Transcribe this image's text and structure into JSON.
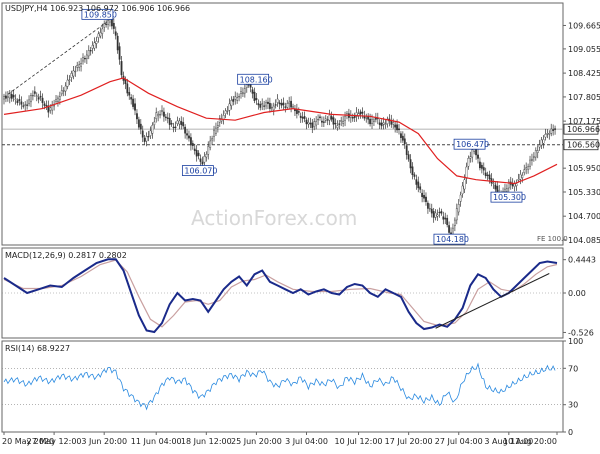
{
  "chart_data": [
    {
      "type": "candlestick",
      "panel": "price",
      "header": "USDJPY,H4  106.923 106.972 106.906 106.966",
      "watermark": "ActionForex.com",
      "fe_label": "FE 100.0",
      "last_price": "106.966",
      "y_ticks": [
        "109.665",
        "109.055",
        "108.425",
        "107.805",
        "107.175",
        "106.560",
        "105.950",
        "105.330",
        "104.700",
        "104.085"
      ],
      "ylim": [
        103.95,
        110.25
      ],
      "x_ticks": [
        "20 May 2020",
        "27 May 12:00",
        "3 Jun 20:00",
        "11 Jun 04:00",
        "18 Jun 12:00",
        "25 Jun 20:00",
        "3 Jul 04:00",
        "10 Jul 12:00",
        "17 Jul 20:00",
        "27 Jul 04:00",
        "3 Aug 12:00",
        "10 Aug 20:00"
      ],
      "annotations": [
        {
          "label": "109.850",
          "value": 109.85
        },
        {
          "label": "106.070",
          "value": 106.07
        },
        {
          "label": "108.160",
          "value": 108.16
        },
        {
          "label": "106.470",
          "value": 106.47
        },
        {
          "label": "105.300",
          "value": 105.3
        },
        {
          "label": "104.180",
          "value": 104.18
        }
      ],
      "level_line": {
        "value": 106.56,
        "label": "106.560"
      },
      "price_path": [
        [
          0,
          107.75
        ],
        [
          4,
          107.85
        ],
        [
          8,
          107.7
        ],
        [
          12,
          107.55
        ],
        [
          16,
          107.9
        ],
        [
          20,
          107.75
        ],
        [
          24,
          107.45
        ],
        [
          28,
          107.7
        ],
        [
          32,
          108.0
        ],
        [
          36,
          108.4
        ],
        [
          40,
          108.65
        ],
        [
          44,
          108.9
        ],
        [
          48,
          109.2
        ],
        [
          52,
          109.6
        ],
        [
          56,
          109.85
        ],
        [
          59,
          109.4
        ],
        [
          62,
          108.4
        ],
        [
          65,
          107.95
        ],
        [
          68,
          107.6
        ],
        [
          71,
          107.05
        ],
        [
          74,
          106.65
        ],
        [
          77,
          106.9
        ],
        [
          80,
          107.35
        ],
        [
          83,
          107.4
        ],
        [
          86,
          107.2
        ],
        [
          89,
          107.0
        ],
        [
          92,
          107.2
        ],
        [
          95,
          106.9
        ],
        [
          98,
          106.6
        ],
        [
          101,
          106.3
        ],
        [
          104,
          106.07
        ],
        [
          107,
          106.5
        ],
        [
          110,
          106.9
        ],
        [
          113,
          107.2
        ],
        [
          116,
          107.4
        ],
        [
          119,
          107.7
        ],
        [
          122,
          107.8
        ],
        [
          125,
          107.95
        ],
        [
          128,
          108.16
        ],
        [
          131,
          107.75
        ],
        [
          134,
          107.55
        ],
        [
          137,
          107.65
        ],
        [
          140,
          107.5
        ],
        [
          143,
          107.7
        ],
        [
          146,
          107.55
        ],
        [
          149,
          107.65
        ],
        [
          152,
          107.45
        ],
        [
          155,
          107.3
        ],
        [
          158,
          107.15
        ],
        [
          161,
          107.05
        ],
        [
          164,
          107.25
        ],
        [
          167,
          107.15
        ],
        [
          170,
          107.3
        ],
        [
          173,
          107.05
        ],
        [
          176,
          107.15
        ],
        [
          179,
          107.35
        ],
        [
          182,
          107.25
        ],
        [
          185,
          107.4
        ],
        [
          188,
          107.3
        ],
        [
          191,
          107.15
        ],
        [
          194,
          107.25
        ],
        [
          197,
          107.05
        ],
        [
          200,
          107.2
        ],
        [
          203,
          107.1
        ],
        [
          206,
          106.9
        ],
        [
          209,
          106.55
        ],
        [
          212,
          105.95
        ],
        [
          215,
          105.55
        ],
        [
          218,
          105.25
        ],
        [
          221,
          104.95
        ],
        [
          224,
          104.7
        ],
        [
          227,
          104.8
        ],
        [
          230,
          104.6
        ],
        [
          233,
          104.18
        ],
        [
          236,
          104.85
        ],
        [
          239,
          105.45
        ],
        [
          242,
          106.2
        ],
        [
          245,
          106.47
        ],
        [
          248,
          106.0
        ],
        [
          251,
          105.8
        ],
        [
          254,
          105.6
        ],
        [
          257,
          105.35
        ],
        [
          260,
          105.3
        ],
        [
          263,
          105.55
        ],
        [
          266,
          105.5
        ],
        [
          269,
          105.75
        ],
        [
          272,
          105.95
        ],
        [
          275,
          106.2
        ],
        [
          278,
          106.45
        ],
        [
          281,
          106.75
        ],
        [
          284,
          106.9
        ],
        [
          287,
          106.97
        ]
      ],
      "ma_path": [
        [
          0,
          107.35
        ],
        [
          20,
          107.5
        ],
        [
          40,
          107.85
        ],
        [
          55,
          108.2
        ],
        [
          62,
          108.3
        ],
        [
          75,
          107.9
        ],
        [
          90,
          107.55
        ],
        [
          105,
          107.25
        ],
        [
          120,
          107.2
        ],
        [
          135,
          107.4
        ],
        [
          150,
          107.5
        ],
        [
          170,
          107.35
        ],
        [
          190,
          107.3
        ],
        [
          205,
          107.15
        ],
        [
          215,
          106.85
        ],
        [
          225,
          106.2
        ],
        [
          235,
          105.75
        ],
        [
          245,
          105.65
        ],
        [
          255,
          105.6
        ],
        [
          265,
          105.55
        ],
        [
          275,
          105.75
        ],
        [
          287,
          106.05
        ]
      ]
    },
    {
      "type": "line",
      "panel": "macd",
      "header": "MACD(12,26,9) 0.2817 0.2802",
      "y_ticks": [
        "0.4443",
        "0.00",
        "-0.526"
      ],
      "ylim": [
        -0.6,
        0.6
      ],
      "macd": [
        [
          0,
          0.2
        ],
        [
          6,
          0.1
        ],
        [
          12,
          0.0
        ],
        [
          18,
          0.05
        ],
        [
          24,
          0.1
        ],
        [
          30,
          0.08
        ],
        [
          36,
          0.2
        ],
        [
          42,
          0.3
        ],
        [
          48,
          0.4
        ],
        [
          54,
          0.45
        ],
        [
          58,
          0.45
        ],
        [
          62,
          0.3
        ],
        [
          66,
          0.0
        ],
        [
          70,
          -0.3
        ],
        [
          74,
          -0.5
        ],
        [
          78,
          -0.52
        ],
        [
          82,
          -0.4
        ],
        [
          86,
          -0.15
        ],
        [
          90,
          0.0
        ],
        [
          94,
          -0.1
        ],
        [
          98,
          -0.08
        ],
        [
          102,
          -0.1
        ],
        [
          106,
          -0.25
        ],
        [
          110,
          -0.1
        ],
        [
          114,
          0.05
        ],
        [
          118,
          0.15
        ],
        [
          122,
          0.22
        ],
        [
          126,
          0.1
        ],
        [
          130,
          0.25
        ],
        [
          134,
          0.3
        ],
        [
          138,
          0.15
        ],
        [
          142,
          0.1
        ],
        [
          146,
          0.05
        ],
        [
          150,
          0.0
        ],
        [
          154,
          0.05
        ],
        [
          158,
          -0.02
        ],
        [
          162,
          0.02
        ],
        [
          166,
          0.05
        ],
        [
          170,
          0.0
        ],
        [
          174,
          -0.02
        ],
        [
          178,
          0.08
        ],
        [
          182,
          0.12
        ],
        [
          186,
          0.1
        ],
        [
          190,
          0.0
        ],
        [
          194,
          -0.05
        ],
        [
          198,
          0.05
        ],
        [
          202,
          0.0
        ],
        [
          206,
          -0.05
        ],
        [
          210,
          -0.25
        ],
        [
          214,
          -0.4
        ],
        [
          218,
          -0.48
        ],
        [
          222,
          -0.46
        ],
        [
          226,
          -0.42
        ],
        [
          230,
          -0.45
        ],
        [
          234,
          -0.35
        ],
        [
          238,
          -0.2
        ],
        [
          242,
          0.1
        ],
        [
          246,
          0.25
        ],
        [
          250,
          0.2
        ],
        [
          254,
          0.05
        ],
        [
          258,
          -0.05
        ],
        [
          262,
          0.0
        ],
        [
          266,
          0.1
        ],
        [
          270,
          0.2
        ],
        [
          274,
          0.3
        ],
        [
          278,
          0.4
        ],
        [
          282,
          0.42
        ],
        [
          287,
          0.4
        ]
      ],
      "signal": [
        [
          0,
          0.18
        ],
        [
          10,
          0.06
        ],
        [
          20,
          0.06
        ],
        [
          30,
          0.1
        ],
        [
          40,
          0.22
        ],
        [
          50,
          0.38
        ],
        [
          58,
          0.44
        ],
        [
          64,
          0.28
        ],
        [
          70,
          -0.05
        ],
        [
          76,
          -0.35
        ],
        [
          82,
          -0.45
        ],
        [
          88,
          -0.3
        ],
        [
          94,
          -0.12
        ],
        [
          100,
          -0.1
        ],
        [
          106,
          -0.15
        ],
        [
          112,
          -0.1
        ],
        [
          118,
          0.08
        ],
        [
          124,
          0.16
        ],
        [
          130,
          0.18
        ],
        [
          136,
          0.24
        ],
        [
          142,
          0.15
        ],
        [
          150,
          0.05
        ],
        [
          160,
          0.02
        ],
        [
          170,
          0.02
        ],
        [
          180,
          0.05
        ],
        [
          190,
          0.06
        ],
        [
          200,
          0.0
        ],
        [
          206,
          -0.02
        ],
        [
          212,
          -0.2
        ],
        [
          218,
          -0.38
        ],
        [
          226,
          -0.44
        ],
        [
          234,
          -0.4
        ],
        [
          240,
          -0.25
        ],
        [
          246,
          0.05
        ],
        [
          252,
          0.15
        ],
        [
          258,
          0.05
        ],
        [
          264,
          0.02
        ],
        [
          270,
          0.12
        ],
        [
          276,
          0.25
        ],
        [
          282,
          0.35
        ],
        [
          287,
          0.38
        ]
      ]
    },
    {
      "type": "line",
      "panel": "rsi",
      "header": "RSI(14) 68.9227",
      "y_ticks": [
        "100",
        "70",
        "30",
        "0"
      ],
      "ylim": [
        0,
        100
      ],
      "levels": [
        70,
        30
      ],
      "rsi": [
        [
          0,
          55
        ],
        [
          6,
          58
        ],
        [
          12,
          52
        ],
        [
          18,
          60
        ],
        [
          24,
          55
        ],
        [
          30,
          62
        ],
        [
          36,
          58
        ],
        [
          42,
          64
        ],
        [
          48,
          60
        ],
        [
          54,
          70
        ],
        [
          58,
          66
        ],
        [
          62,
          48
        ],
        [
          66,
          40
        ],
        [
          70,
          32
        ],
        [
          74,
          28
        ],
        [
          78,
          38
        ],
        [
          82,
          52
        ],
        [
          86,
          60
        ],
        [
          90,
          55
        ],
        [
          94,
          58
        ],
        [
          98,
          46
        ],
        [
          102,
          38
        ],
        [
          106,
          45
        ],
        [
          110,
          55
        ],
        [
          114,
          60
        ],
        [
          118,
          63
        ],
        [
          122,
          58
        ],
        [
          126,
          66
        ],
        [
          130,
          62
        ],
        [
          134,
          68
        ],
        [
          138,
          55
        ],
        [
          142,
          50
        ],
        [
          146,
          58
        ],
        [
          150,
          52
        ],
        [
          154,
          60
        ],
        [
          158,
          50
        ],
        [
          162,
          56
        ],
        [
          166,
          52
        ],
        [
          170,
          58
        ],
        [
          174,
          48
        ],
        [
          178,
          60
        ],
        [
          182,
          55
        ],
        [
          186,
          62
        ],
        [
          190,
          50
        ],
        [
          194,
          58
        ],
        [
          198,
          52
        ],
        [
          202,
          60
        ],
        [
          206,
          48
        ],
        [
          210,
          36
        ],
        [
          214,
          40
        ],
        [
          218,
          34
        ],
        [
          222,
          38
        ],
        [
          226,
          30
        ],
        [
          230,
          44
        ],
        [
          234,
          32
        ],
        [
          238,
          55
        ],
        [
          242,
          68
        ],
        [
          246,
          72
        ],
        [
          250,
          50
        ],
        [
          254,
          46
        ],
        [
          258,
          44
        ],
        [
          262,
          50
        ],
        [
          266,
          55
        ],
        [
          270,
          60
        ],
        [
          274,
          64
        ],
        [
          278,
          66
        ],
        [
          282,
          70
        ],
        [
          287,
          69
        ]
      ]
    }
  ]
}
